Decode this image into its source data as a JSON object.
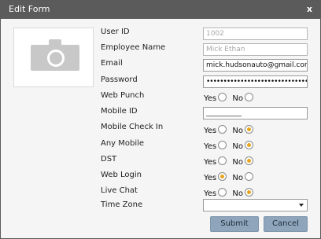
{
  "dialog": {
    "title": "Edit Form",
    "close_label": "x"
  },
  "photo": {
    "icon": "camera-icon"
  },
  "fields": {
    "user_id": {
      "label": "User ID",
      "value": "1002"
    },
    "employee_name": {
      "label": "Employee Name",
      "value": "Mick Ethan"
    },
    "email": {
      "label": "Email",
      "value": "mick.hudsonauto@gmail.com"
    },
    "password": {
      "label": "Password",
      "value": "••••••••••••••••••••••••••••••••••"
    },
    "mobile_id": {
      "label": "Mobile ID",
      "value": "__________"
    },
    "time_zone": {
      "label": "Time Zone",
      "value": ""
    }
  },
  "radios": {
    "yes": "Yes",
    "no": "No",
    "web_punch": {
      "label": "Web Punch",
      "selected": "none"
    },
    "mobile_check_in": {
      "label": "Mobile Check In",
      "selected": "no"
    },
    "any_mobile": {
      "label": "Any Mobile",
      "selected": "no"
    },
    "dst": {
      "label": "DST",
      "selected": "no"
    },
    "web_login": {
      "label": "Web Login",
      "selected": "yes"
    },
    "live_chat": {
      "label": "Live Chat",
      "selected": "no"
    }
  },
  "buttons": {
    "submit": "Submit",
    "cancel": "Cancel"
  },
  "colors": {
    "titlebar": "#5b5b5b",
    "radio_selected": "#e8a41d",
    "button_bg": "#8fa5bb"
  }
}
